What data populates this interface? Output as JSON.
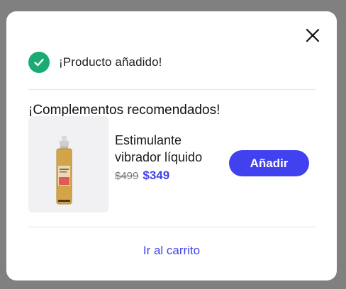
{
  "modal": {
    "close_icon": "close-icon",
    "added_icon": "check-circle-icon",
    "added_message": "¡Producto añadido!",
    "accent_color": "#4141f0",
    "success_color": "#1aaa73"
  },
  "recommendations": {
    "title": "¡Complementos recomendados!",
    "items": [
      {
        "name": "Estimulante vibrador líquido",
        "old_price": "$499",
        "new_price": "$349",
        "add_label": "Añadir"
      }
    ]
  },
  "footer": {
    "cart_link_label": "Ir al carrito"
  }
}
